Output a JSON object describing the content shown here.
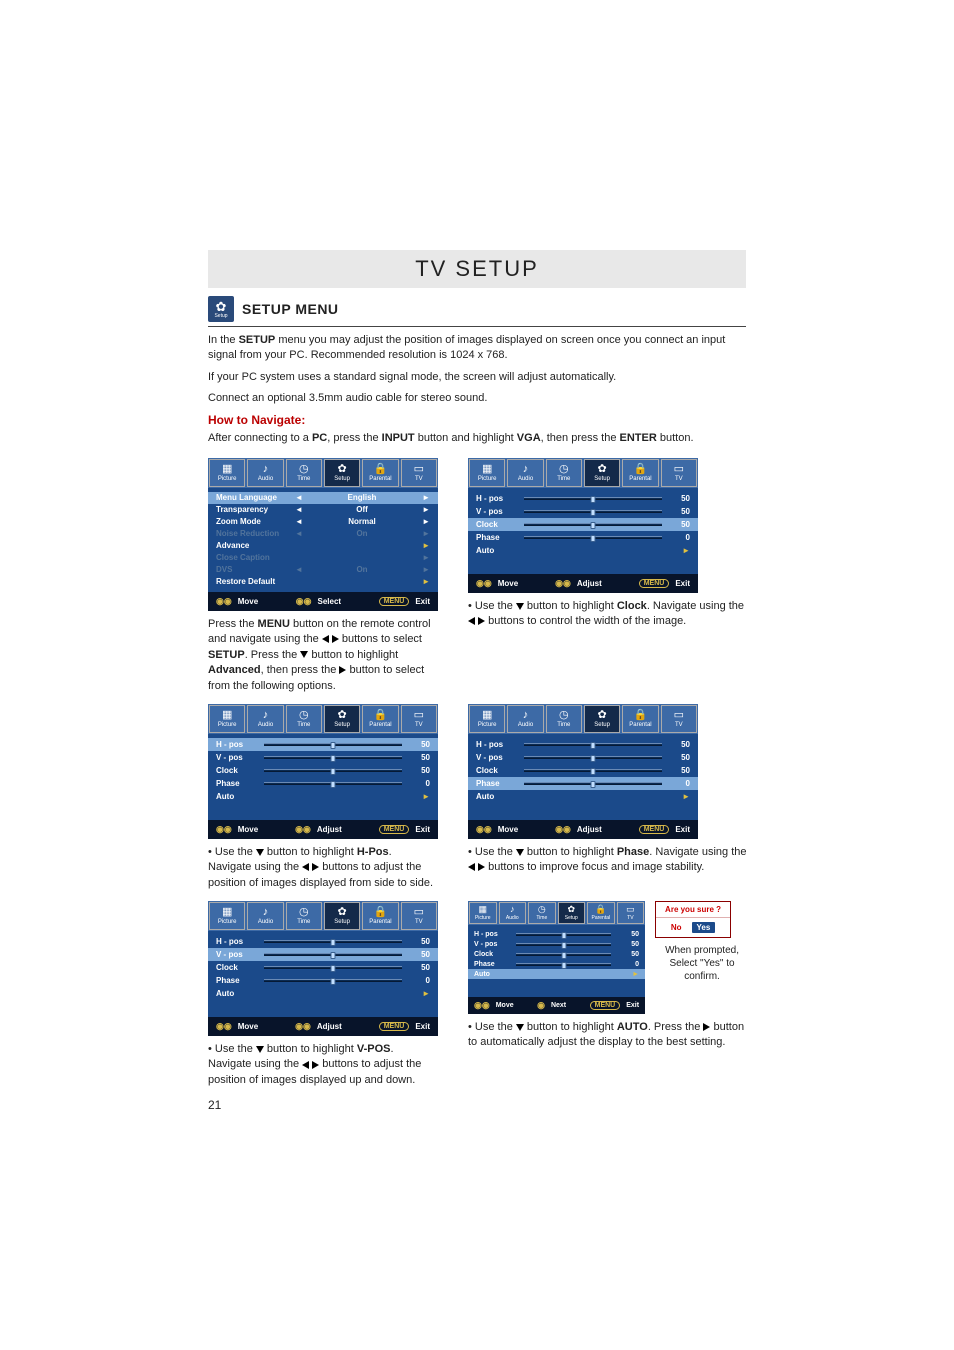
{
  "page_title": "TV SETUP",
  "section_title": "SETUP MENU",
  "setup_icon_label": "Setup",
  "intro_1a": "In the ",
  "intro_1b": "SETUP",
  "intro_1c": " menu you may adjust the position of images displayed on screen once you connect an input signal from your PC. Recommended resolution is 1024 x 768.",
  "intro_2": "If your PC system uses a standard signal mode, the screen will adjust automatically.",
  "intro_3": "Connect an optional 3.5mm audio cable for stereo sound.",
  "navigate_head": "How to Navigate:",
  "nav_a": "After connecting to a ",
  "nav_b": "PC",
  "nav_c": ", press the ",
  "nav_d": "INPUT",
  "nav_e": " button and highlight ",
  "nav_f": "VGA",
  "nav_g": ", then press the ",
  "nav_h": "ENTER",
  "nav_i": " button.",
  "tabs": {
    "picture": "Picture",
    "audio": "Audio",
    "time": "Time",
    "setup": "Setup",
    "parental": "Parental",
    "tv": "TV"
  },
  "tab_icons": {
    "picture": "▦",
    "audio": "♪",
    "time": "◷",
    "setup": "✿",
    "parental": "🔒",
    "tv": "▭"
  },
  "menu_labels": {
    "menu_language": "Menu Language",
    "transparency": "Transparency",
    "zoom_mode": "Zoom Mode",
    "noise_reduction": "Noise Reduction",
    "advance": "Advance",
    "close_caption": "Close Caption",
    "dvs": "DVS",
    "restore_default": "Restore Default"
  },
  "menu_values": {
    "english": "English",
    "off": "Off",
    "normal": "Normal",
    "on_disabled": "On",
    "on": "On"
  },
  "slider_labels": {
    "hpos": "H - pos",
    "vpos": "V - pos",
    "clock": "Clock",
    "phase": "Phase",
    "auto": "Auto"
  },
  "vals": {
    "fifty": "50",
    "zero": "0"
  },
  "foot": {
    "move": "Move",
    "select": "Select",
    "adjust": "Adjust",
    "next": "Next",
    "menu": "MENU",
    "exit": "Exit"
  },
  "cap1_a": "Press the ",
  "cap1_b": "MENU",
  "cap1_c": " button on the remote control and navigate using the ",
  "cap1_d": " buttons to select ",
  "cap1_e": "SETUP",
  "cap1_f": ". Press the ",
  "cap1_g": " button to highlight ",
  "cap1_h": "Advanced",
  "cap1_i": ", then press the ",
  "cap1_j": " button to select from the following options.",
  "cap2_a": "• Use the ",
  "cap2_b": " button to highlight ",
  "cap2_c": "H-Pos",
  "cap2_d": ". Navigate using the ",
  "cap2_e": " buttons to adjust the position of images displayed from side to side.",
  "cap3_c": "V-POS",
  "cap3_e": " buttons to adjust the position of images displayed up and down.",
  "cap4_c": "Clock",
  "cap4_e": " buttons to control the width of the image.",
  "cap5_c": "Phase",
  "cap5_e": " buttons to improve focus and image stability.",
  "cap6_c": "AUTO",
  "cap6_d": ". Press the ",
  "cap6_e": " button to automatically adjust the display to the best setting.",
  "prompt_head": "Are you sure ?",
  "prompt_no": "No",
  "prompt_yes": "Yes",
  "prompt_caption1": "When prompted,",
  "prompt_caption2": "Select \"Yes\" to confirm.",
  "page_number": "21"
}
